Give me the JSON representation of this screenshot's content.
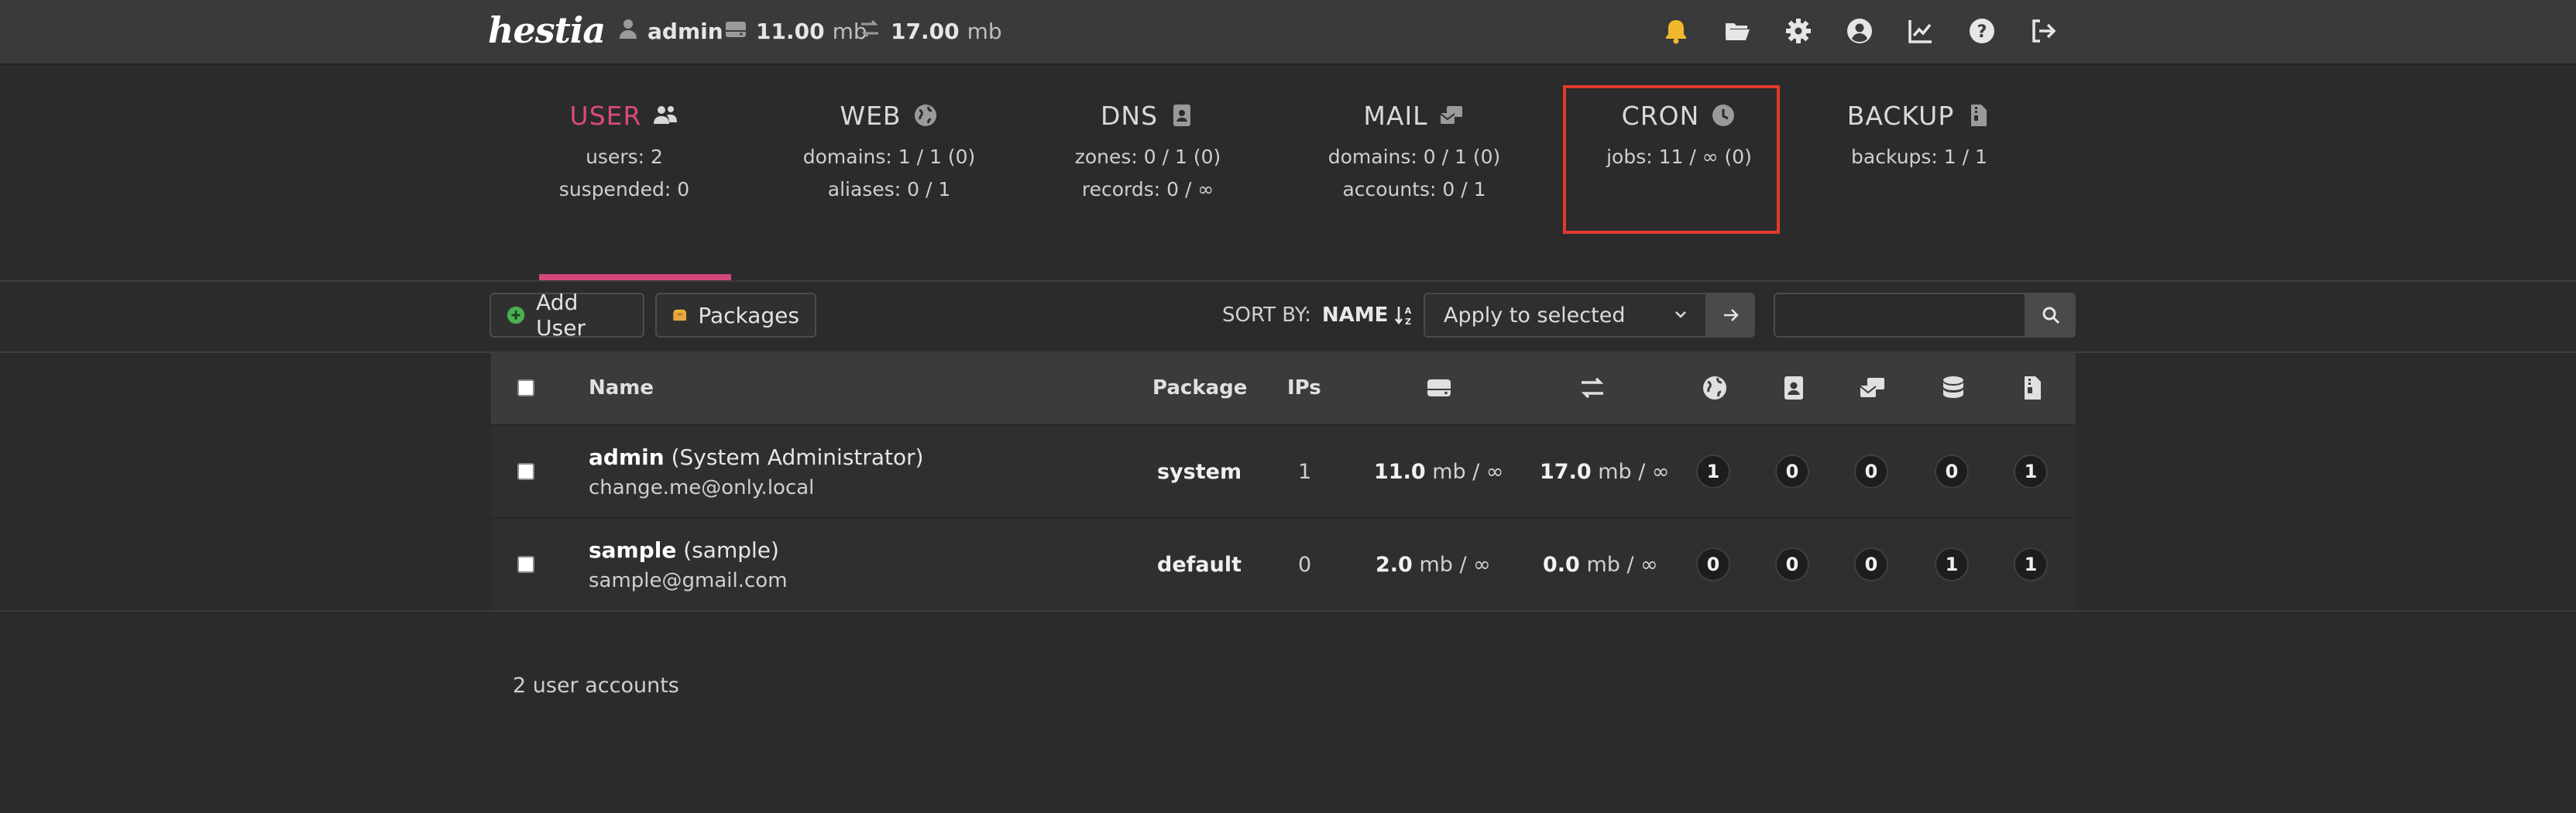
{
  "topbar": {
    "logo": "hestia",
    "user": "admin",
    "disk_value": "11.00",
    "disk_unit": "mb",
    "bandwidth_value": "17.00",
    "bandwidth_unit": "mb",
    "icons": [
      "bell-icon",
      "folder-icon",
      "gear-icon",
      "user-circle-icon",
      "chart-icon",
      "help-icon",
      "logout-icon"
    ],
    "bell_color": "#f1b82d"
  },
  "nav": {
    "tabs": [
      {
        "title": "USER",
        "line1": "users: 2",
        "line2": "suspended: 0",
        "active": true
      },
      {
        "title": "WEB",
        "line1": "domains: 1 / 1 (0)",
        "line2": "aliases: 0 / 1"
      },
      {
        "title": "DNS",
        "line1": "zones: 0 / 1 (0)",
        "line2": "records: 0 / ∞"
      },
      {
        "title": "MAIL",
        "line1": "domains: 0 / 1 (0)",
        "line2": "accounts: 0 / 1"
      },
      {
        "title": "CRON",
        "line1": "jobs: 11 / ∞ (0)",
        "line2": ""
      },
      {
        "title": "BACKUP",
        "line1": "backups: 1 / 1",
        "line2": ""
      }
    ],
    "active_color": "#d3477b",
    "highlight_color": "#e23a2b"
  },
  "toolbar": {
    "add_user": "Add User",
    "packages": "Packages",
    "sort_label": "SORT BY:",
    "sort_value": "NAME",
    "apply_selected": "Apply to selected",
    "search_value": ""
  },
  "table": {
    "headers": {
      "name": "Name",
      "package": "Package",
      "ips": "IPs"
    },
    "rows": [
      {
        "name": "admin",
        "full": "(System Administrator)",
        "email": "change.me@only.local",
        "package": "system",
        "ips": "1",
        "disk_val": "11.0",
        "disk_rest": "mb / ∞",
        "bw_val": "17.0",
        "bw_rest": "mb / ∞",
        "web": "1",
        "dns": "0",
        "mail": "0",
        "db": "0",
        "backup": "1"
      },
      {
        "name": "sample",
        "full": "(sample)",
        "email": "sample@gmail.com",
        "package": "default",
        "ips": "0",
        "disk_val": "2.0",
        "disk_rest": "mb / ∞",
        "bw_val": "0.0",
        "bw_rest": "mb / ∞",
        "web": "0",
        "dns": "0",
        "mail": "0",
        "db": "1",
        "backup": "1"
      }
    ]
  },
  "footer": {
    "count_text": "2 user accounts"
  }
}
